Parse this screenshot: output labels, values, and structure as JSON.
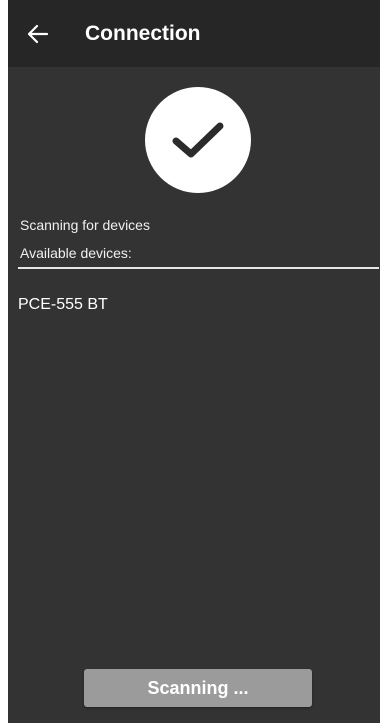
{
  "app_bar": {
    "title": "Connection",
    "back_icon": "arrow-left-icon"
  },
  "status": {
    "icon": "checkmark-icon",
    "text": "Scanning for devices"
  },
  "devices": {
    "label": "Available devices:",
    "items": [
      {
        "name": "PCE-555 BT"
      }
    ]
  },
  "scan_button": {
    "label": "Scanning ...",
    "enabled": false
  },
  "colors": {
    "background": "#333333",
    "app_bar": "#262626",
    "button_disabled": "#9b9b9b",
    "text": "#ffffff"
  }
}
